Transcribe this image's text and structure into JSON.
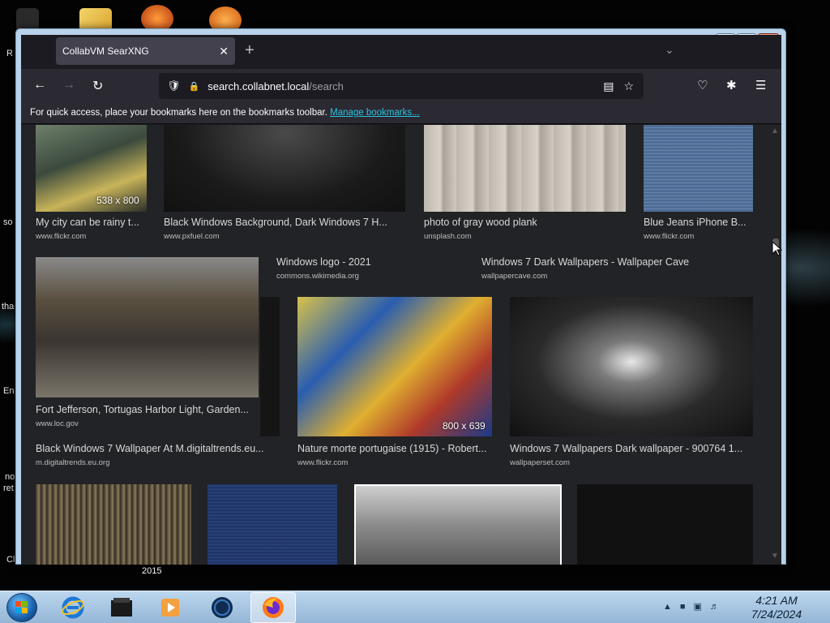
{
  "browser": {
    "tab_title": "CollabVM SearXNG",
    "url_host": "search.collabnet.local",
    "url_path": "/search",
    "bookmarks_message": "For quick access, place your bookmarks here on the bookmarks toolbar.",
    "bookmarks_link": "Manage bookmarks..."
  },
  "results": [
    {
      "title": "My city can be rainy t...",
      "url": "www.flickr.com",
      "dims": "538 x 800"
    },
    {
      "title": "Black Windows Background, Dark Windows 7 H...",
      "url": "www.pxfuel.com"
    },
    {
      "title": "photo of gray wood plank",
      "url": "unsplash.com"
    },
    {
      "title": "Blue Jeans iPhone B...",
      "url": "www.flickr.com"
    },
    {
      "title": "Windows logo - 2021",
      "url": "commons.wikimedia.org"
    },
    {
      "title": "Windows 7 Dark Wallpapers - Wallpaper Cave",
      "url": "wallpapercave.com"
    },
    {
      "title": "Fort Jefferson, Tortugas Harbor Light, Garden...",
      "url": "www.loc.gov"
    },
    {
      "title": "Black Windows 7 Wallpaper At M.digitaltrends.eu...",
      "url": "m.digitaltrends.eu.org"
    },
    {
      "title": "Nature morte portugaise (1915) - Robert...",
      "url": "www.flickr.com",
      "dims": "800 x 639"
    },
    {
      "title": "Windows 7 Wallpapers Dark wallpaper - 900764 1...",
      "url": "wallpaperset.com"
    }
  ],
  "desktop": {
    "label_2015": "2015",
    "fragments": [
      "R",
      "so",
      "tha",
      "En",
      "no",
      "ret",
      "Cl"
    ]
  },
  "taskbar": {
    "time": "4:21 AM",
    "date": "7/24/2024"
  },
  "colors": {
    "ff_dark": "#1c1b22",
    "ff_toolbar": "#2b2a33",
    "ff_tab": "#42414d",
    "link": "#2ac3de",
    "taskbar": "#bcd6ee"
  }
}
